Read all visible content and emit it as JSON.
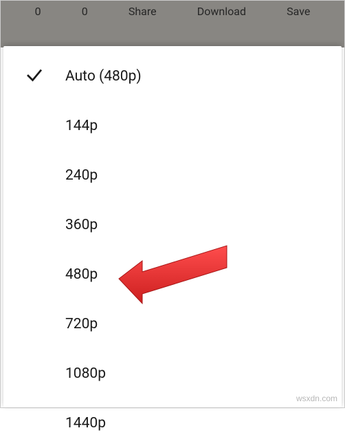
{
  "backdrop": {
    "count1": "0",
    "count2": "0",
    "share": "Share",
    "download": "Download",
    "save": "Save"
  },
  "menu": {
    "items": [
      {
        "label": "Auto (480p)",
        "selected": true
      },
      {
        "label": "144p",
        "selected": false
      },
      {
        "label": "240p",
        "selected": false
      },
      {
        "label": "360p",
        "selected": false
      },
      {
        "label": "480p",
        "selected": false
      },
      {
        "label": "720p",
        "selected": false
      },
      {
        "label": "1080p",
        "selected": false
      },
      {
        "label": "1440p",
        "selected": false
      }
    ]
  },
  "annotation": {
    "arrow_color": "#e62e2e",
    "points_to": "480p"
  },
  "watermark": "wsxdn.com"
}
